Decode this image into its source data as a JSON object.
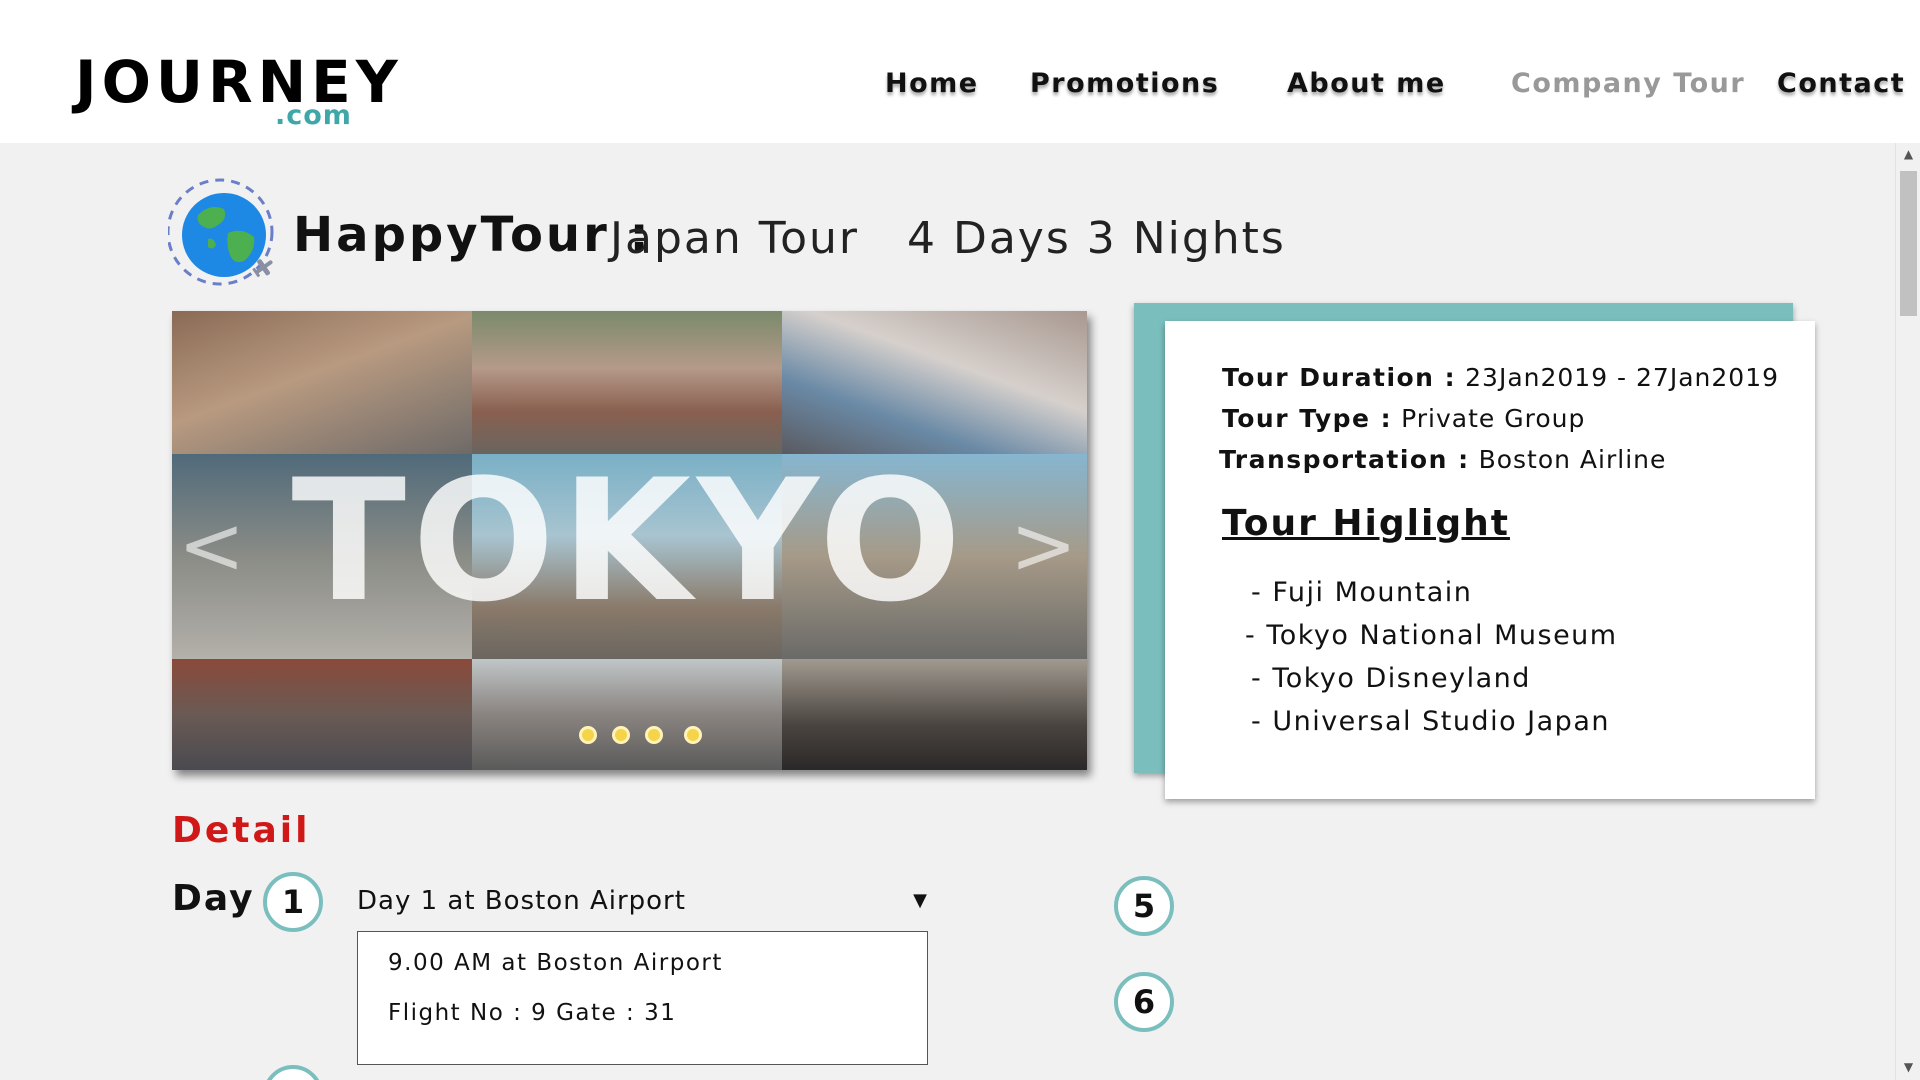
{
  "header": {
    "logo_main": "JOURNEY",
    "logo_sub": ".com",
    "nav": {
      "home": "Home",
      "promotions": "Promotions",
      "about": "About me",
      "company_tour": "Company Tour",
      "contact": "Contact"
    },
    "active_nav": "Company Tour"
  },
  "tour": {
    "brand": "HappyTour :",
    "title": "Japan Tour   4 Days 3 Nights",
    "icon": "globe-plane-icon"
  },
  "carousel": {
    "overlay_text": "TOKYO",
    "prev_arrow": "<",
    "next_arrow": ">",
    "slide_count": 4,
    "active_slide": 1
  },
  "info": {
    "duration_label": "Tour Duration :",
    "duration_value": "23Jan2019 - 27Jan2019",
    "type_label": "Tour Type :",
    "type_value": "Private Group",
    "transport_label": "Transportation :",
    "transport_value": "Boston Airline",
    "highlight_title": "Tour Higlight",
    "highlights": [
      "- Fuji Mountain",
      "- Tokyo National Museum",
      "- Tokyo Disneyland",
      "- Universal Studio Japan"
    ]
  },
  "detail": {
    "title": "Detail",
    "day_label": "Day",
    "days": [
      "1",
      "5",
      "6"
    ],
    "selected_day": "Day 1 at Boston Airport",
    "day_lines": [
      "9.00 AM at Boston Airport",
      "Flight No : 9  Gate : 31"
    ]
  },
  "colors": {
    "accent_teal": "#7abfbe",
    "logo_teal": "#3fa7a7",
    "detail_red": "#d11818",
    "nav_active_gray": "#999999"
  }
}
